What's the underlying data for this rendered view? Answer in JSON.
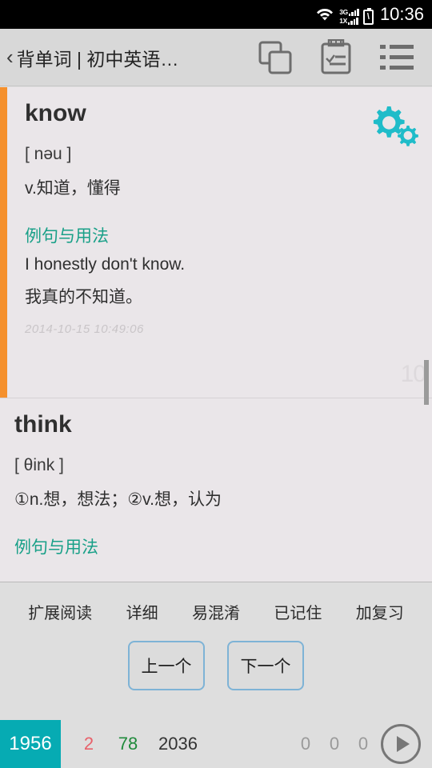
{
  "status_bar": {
    "wifi_icon": "wifi-icon",
    "signal_3g_label": "3G",
    "signal_1x_label": "1X",
    "battery_icon": "battery-charging-icon",
    "time": "10:36"
  },
  "title_bar": {
    "back_icon": "‹",
    "title": "背单词 | 初中英语…",
    "icons": [
      {
        "name": "copy-layers-icon"
      },
      {
        "name": "clipboard-checklist-icon"
      },
      {
        "name": "list-menu-icon"
      }
    ]
  },
  "cards": [
    {
      "word": "know",
      "phonetic": "[ nəu ]",
      "meaning": "v.知道，懂得",
      "example_heading": "例句与用法",
      "example_en": "I honestly don't know.",
      "example_cn": "我真的不知道。",
      "timestamp": "2014-10-15 10:49:06",
      "watermark": "10",
      "settings_icon": "gears-icon",
      "active": true
    },
    {
      "word": "think",
      "phonetic": "[ θink ]",
      "meaning": "①n.想，想法；②v.想，认为",
      "example_heading": "例句与用法",
      "active": false
    }
  ],
  "bottom_panel": {
    "menu": [
      {
        "label": "扩展阅读"
      },
      {
        "label": "详细"
      },
      {
        "label": "易混淆"
      },
      {
        "label": "已记住"
      },
      {
        "label": "加复习"
      }
    ],
    "prev_button": "上一个",
    "next_button": "下一个"
  },
  "bottom_bar": {
    "main_count": "1956",
    "count_red": "2",
    "count_green": "78",
    "count_total": "2036",
    "zeros": [
      "0",
      "0",
      "0"
    ],
    "play_icon": "play-circle-icon"
  },
  "colors": {
    "accent_orange": "#f5902d",
    "teal_heading": "#19a088",
    "teal_block": "#06abb3",
    "gear_cyan": "#1fbcc9",
    "button_border": "#7eb3d6",
    "count_red": "#e8616a",
    "count_green": "#1f8a3b"
  }
}
